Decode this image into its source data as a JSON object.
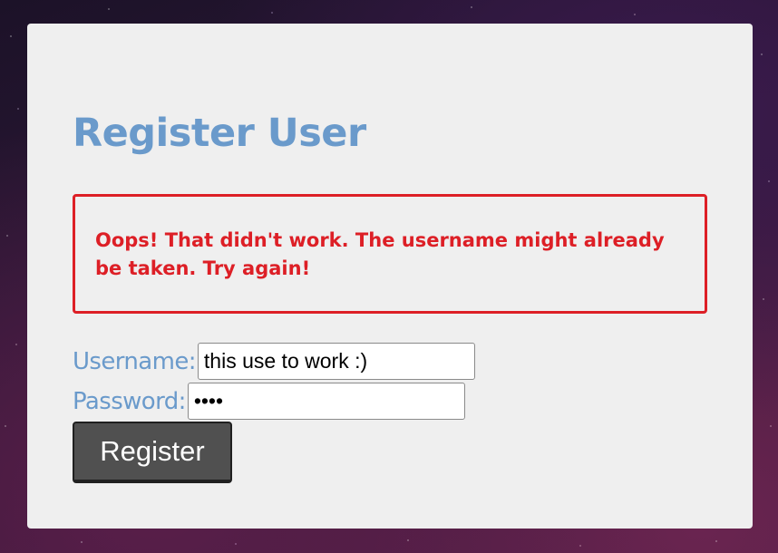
{
  "page": {
    "title": "Register User"
  },
  "error": {
    "message": "Oops! That didn't work. The username might already be taken. Try again!"
  },
  "form": {
    "username_label": "Username:",
    "username_value": "this use to work :)",
    "password_label": "Password:",
    "password_value": "test",
    "submit_label": "Register"
  },
  "colors": {
    "accent": "#6a9acb",
    "error": "#dd1f26",
    "panel_bg": "#efefef",
    "button_bg": "#505050"
  }
}
